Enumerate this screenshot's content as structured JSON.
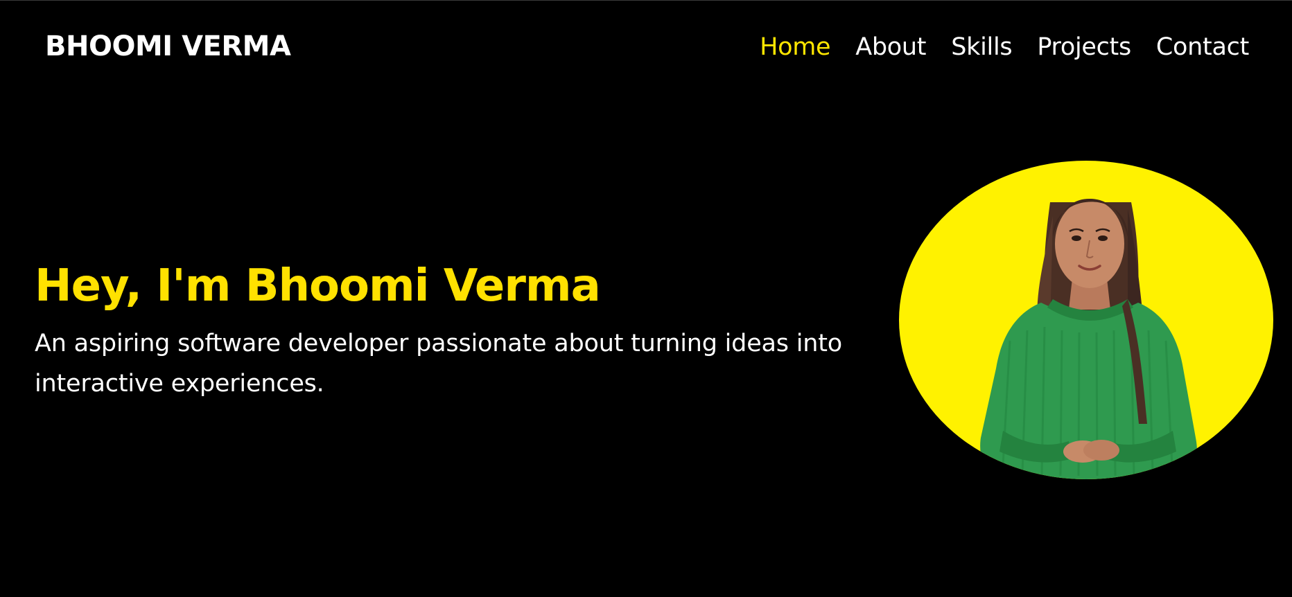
{
  "header": {
    "brand": "BHOOMI VERMA",
    "nav": [
      {
        "label": "Home",
        "active": true
      },
      {
        "label": "About",
        "active": false
      },
      {
        "label": "Skills",
        "active": false
      },
      {
        "label": "Projects",
        "active": false
      },
      {
        "label": "Contact",
        "active": false
      }
    ]
  },
  "hero": {
    "title": "Hey, I'm Bhoomi Verma",
    "subtitle": "An aspiring software developer passionate about turning ideas into interactive experiences.",
    "portrait_icon": "person-portrait-icon"
  },
  "colors": {
    "background": "#000000",
    "accent": "#ffe100",
    "text": "#ffffff",
    "portrait_bg": "#fff200",
    "sweater": "#2f9a4f"
  }
}
